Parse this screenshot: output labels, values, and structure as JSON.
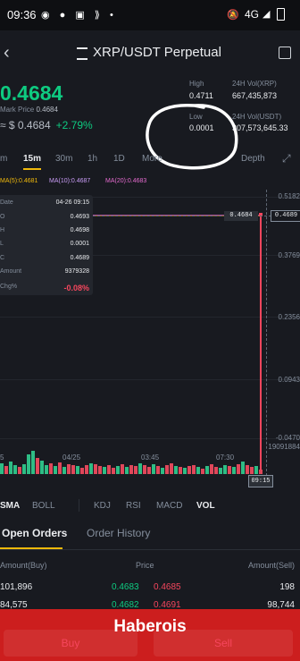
{
  "status": {
    "time": "09:36",
    "network": "4G"
  },
  "header": {
    "title": "XRP/USDT Perpetual"
  },
  "ticker": {
    "price": "0.4684",
    "mark_label": "Mark Price",
    "mark_value": "0.4684",
    "approx": "≈ $ 0.4684",
    "change": "+2.79%",
    "high_label": "High",
    "high_value": "0.4711",
    "low_label": "Low",
    "low_value": "0.0001",
    "vol_xrp_label": "24H Vol(XRP)",
    "vol_xrp_value": "667,435,873",
    "vol_usdt_label": "24H Vol(USDT)",
    "vol_usdt_value": "307,573,645.33"
  },
  "intervals": [
    "m",
    "15m",
    "30m",
    "1h",
    "1D",
    "More",
    "Depth"
  ],
  "ma": {
    "ma5": "MA(5):0.4681",
    "ma10": "MA(10):0.4687",
    "ma20": "MA(20):0.4683"
  },
  "tooltip": {
    "date_label": "Date",
    "date": "04-26 09:15",
    "o_label": "O",
    "o": "0.4693",
    "h_label": "H",
    "h": "0.4698",
    "l_label": "L",
    "l": "0.0001",
    "c_label": "C",
    "c": "0.4689",
    "amount_label": "Amount",
    "amount": "9379328",
    "chg_label": "Chg%",
    "chg": "-0.08%"
  },
  "chart": {
    "last_price_tag": "0.4684",
    "right_tag": "0.4689",
    "y_labels": [
      "0.5182",
      "0.3769",
      "0.2356",
      "0.0943",
      "-0.0470"
    ],
    "volume_label": "19091884",
    "x_labels": [
      "5",
      "04/25",
      "03:45",
      "07:30"
    ],
    "time_tag": "09:15"
  },
  "indicators": [
    "SMA",
    "BOLL",
    "KDJ",
    "RSI",
    "MACD",
    "VOL"
  ],
  "orders": {
    "tabs": [
      "Open Orders",
      "Order History"
    ],
    "headers": {
      "amount_buy": "Amount(Buy)",
      "price": "Price",
      "amount_sell": "Amount(Sell)"
    },
    "rows": [
      {
        "buy": "101,896",
        "bid": "0.4683",
        "ask": "0.4685",
        "sell": "198"
      },
      {
        "buy": "84,575",
        "bid": "0.4682",
        "ask": "0.4691",
        "sell": "98,744"
      }
    ]
  },
  "banner": {
    "brand": "Haberois",
    "buy": "Buy",
    "sell": "Sell"
  },
  "colors": {
    "green": "#0ecb81",
    "red": "#f6465d",
    "accent": "#f0b90b",
    "bg": "#181a20"
  }
}
